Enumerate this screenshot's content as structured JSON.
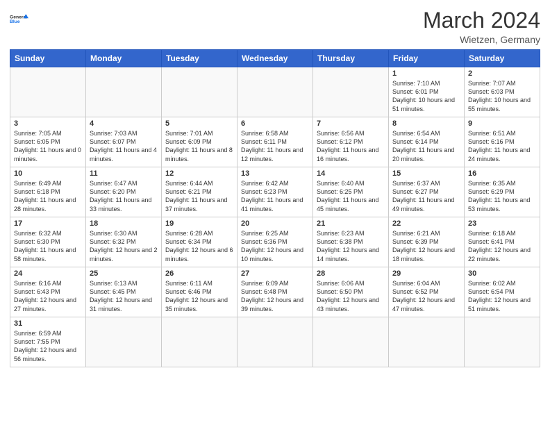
{
  "header": {
    "logo_line1": "General",
    "logo_line2": "Blue",
    "month": "March 2024",
    "location": "Wietzen, Germany"
  },
  "days_of_week": [
    "Sunday",
    "Monday",
    "Tuesday",
    "Wednesday",
    "Thursday",
    "Friday",
    "Saturday"
  ],
  "weeks": [
    [
      {
        "date": "",
        "info": ""
      },
      {
        "date": "",
        "info": ""
      },
      {
        "date": "",
        "info": ""
      },
      {
        "date": "",
        "info": ""
      },
      {
        "date": "",
        "info": ""
      },
      {
        "date": "1",
        "info": "Sunrise: 7:10 AM\nSunset: 6:01 PM\nDaylight: 10 hours and 51 minutes."
      },
      {
        "date": "2",
        "info": "Sunrise: 7:07 AM\nSunset: 6:03 PM\nDaylight: 10 hours and 55 minutes."
      }
    ],
    [
      {
        "date": "3",
        "info": "Sunrise: 7:05 AM\nSunset: 6:05 PM\nDaylight: 11 hours and 0 minutes."
      },
      {
        "date": "4",
        "info": "Sunrise: 7:03 AM\nSunset: 6:07 PM\nDaylight: 11 hours and 4 minutes."
      },
      {
        "date": "5",
        "info": "Sunrise: 7:01 AM\nSunset: 6:09 PM\nDaylight: 11 hours and 8 minutes."
      },
      {
        "date": "6",
        "info": "Sunrise: 6:58 AM\nSunset: 6:11 PM\nDaylight: 11 hours and 12 minutes."
      },
      {
        "date": "7",
        "info": "Sunrise: 6:56 AM\nSunset: 6:12 PM\nDaylight: 11 hours and 16 minutes."
      },
      {
        "date": "8",
        "info": "Sunrise: 6:54 AM\nSunset: 6:14 PM\nDaylight: 11 hours and 20 minutes."
      },
      {
        "date": "9",
        "info": "Sunrise: 6:51 AM\nSunset: 6:16 PM\nDaylight: 11 hours and 24 minutes."
      }
    ],
    [
      {
        "date": "10",
        "info": "Sunrise: 6:49 AM\nSunset: 6:18 PM\nDaylight: 11 hours and 28 minutes."
      },
      {
        "date": "11",
        "info": "Sunrise: 6:47 AM\nSunset: 6:20 PM\nDaylight: 11 hours and 33 minutes."
      },
      {
        "date": "12",
        "info": "Sunrise: 6:44 AM\nSunset: 6:21 PM\nDaylight: 11 hours and 37 minutes."
      },
      {
        "date": "13",
        "info": "Sunrise: 6:42 AM\nSunset: 6:23 PM\nDaylight: 11 hours and 41 minutes."
      },
      {
        "date": "14",
        "info": "Sunrise: 6:40 AM\nSunset: 6:25 PM\nDaylight: 11 hours and 45 minutes."
      },
      {
        "date": "15",
        "info": "Sunrise: 6:37 AM\nSunset: 6:27 PM\nDaylight: 11 hours and 49 minutes."
      },
      {
        "date": "16",
        "info": "Sunrise: 6:35 AM\nSunset: 6:29 PM\nDaylight: 11 hours and 53 minutes."
      }
    ],
    [
      {
        "date": "17",
        "info": "Sunrise: 6:32 AM\nSunset: 6:30 PM\nDaylight: 11 hours and 58 minutes."
      },
      {
        "date": "18",
        "info": "Sunrise: 6:30 AM\nSunset: 6:32 PM\nDaylight: 12 hours and 2 minutes."
      },
      {
        "date": "19",
        "info": "Sunrise: 6:28 AM\nSunset: 6:34 PM\nDaylight: 12 hours and 6 minutes."
      },
      {
        "date": "20",
        "info": "Sunrise: 6:25 AM\nSunset: 6:36 PM\nDaylight: 12 hours and 10 minutes."
      },
      {
        "date": "21",
        "info": "Sunrise: 6:23 AM\nSunset: 6:38 PM\nDaylight: 12 hours and 14 minutes."
      },
      {
        "date": "22",
        "info": "Sunrise: 6:21 AM\nSunset: 6:39 PM\nDaylight: 12 hours and 18 minutes."
      },
      {
        "date": "23",
        "info": "Sunrise: 6:18 AM\nSunset: 6:41 PM\nDaylight: 12 hours and 22 minutes."
      }
    ],
    [
      {
        "date": "24",
        "info": "Sunrise: 6:16 AM\nSunset: 6:43 PM\nDaylight: 12 hours and 27 minutes."
      },
      {
        "date": "25",
        "info": "Sunrise: 6:13 AM\nSunset: 6:45 PM\nDaylight: 12 hours and 31 minutes."
      },
      {
        "date": "26",
        "info": "Sunrise: 6:11 AM\nSunset: 6:46 PM\nDaylight: 12 hours and 35 minutes."
      },
      {
        "date": "27",
        "info": "Sunrise: 6:09 AM\nSunset: 6:48 PM\nDaylight: 12 hours and 39 minutes."
      },
      {
        "date": "28",
        "info": "Sunrise: 6:06 AM\nSunset: 6:50 PM\nDaylight: 12 hours and 43 minutes."
      },
      {
        "date": "29",
        "info": "Sunrise: 6:04 AM\nSunset: 6:52 PM\nDaylight: 12 hours and 47 minutes."
      },
      {
        "date": "30",
        "info": "Sunrise: 6:02 AM\nSunset: 6:54 PM\nDaylight: 12 hours and 51 minutes."
      }
    ],
    [
      {
        "date": "31",
        "info": "Sunrise: 6:59 AM\nSunset: 7:55 PM\nDaylight: 12 hours and 56 minutes."
      },
      {
        "date": "",
        "info": ""
      },
      {
        "date": "",
        "info": ""
      },
      {
        "date": "",
        "info": ""
      },
      {
        "date": "",
        "info": ""
      },
      {
        "date": "",
        "info": ""
      },
      {
        "date": "",
        "info": ""
      }
    ]
  ]
}
